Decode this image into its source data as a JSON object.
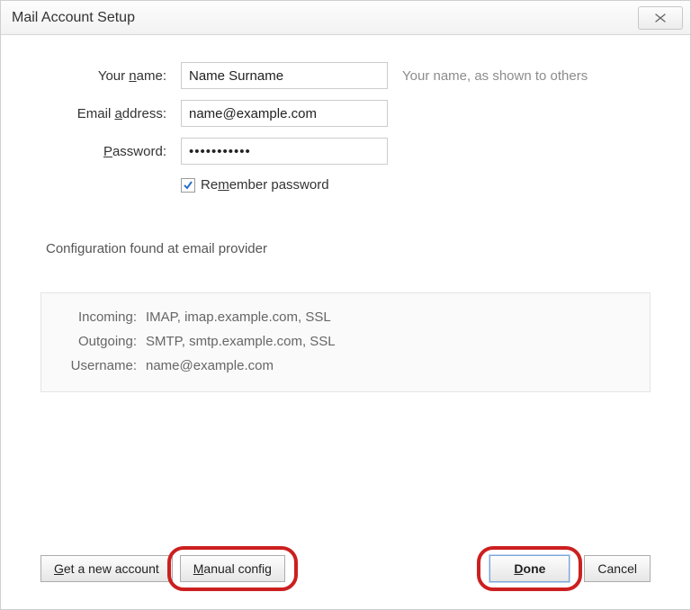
{
  "window": {
    "title": "Mail Account Setup"
  },
  "form": {
    "name": {
      "label_pre": "Your ",
      "label_u": "n",
      "label_post": "ame:",
      "value": "Name Surname",
      "hint": "Your name, as shown to others"
    },
    "email": {
      "label_pre": "Email ",
      "label_u": "a",
      "label_post": "ddress:",
      "value": "name@example.com"
    },
    "password": {
      "label_u": "P",
      "label_post": "assword:",
      "value": "•••••••••••"
    },
    "remember": {
      "label_pre": "Re",
      "label_u": "m",
      "label_post": "ember password",
      "checked": true
    }
  },
  "status": "Configuration found at email provider",
  "config": {
    "incoming": {
      "label": "Incoming:",
      "protocol": "IMAP",
      "server": "imap.example.com",
      "security": "SSL"
    },
    "outgoing": {
      "label": "Outgoing:",
      "protocol": "SMTP",
      "server": "smtp.example.com",
      "security": "SSL"
    },
    "username": {
      "label": "Username:",
      "value": "name@example.com"
    }
  },
  "buttons": {
    "new_account_u": "G",
    "new_account_post": "et a new account",
    "manual_u": "M",
    "manual_post": "anual config",
    "done_u": "D",
    "done_post": "one",
    "cancel": "Cancel"
  }
}
